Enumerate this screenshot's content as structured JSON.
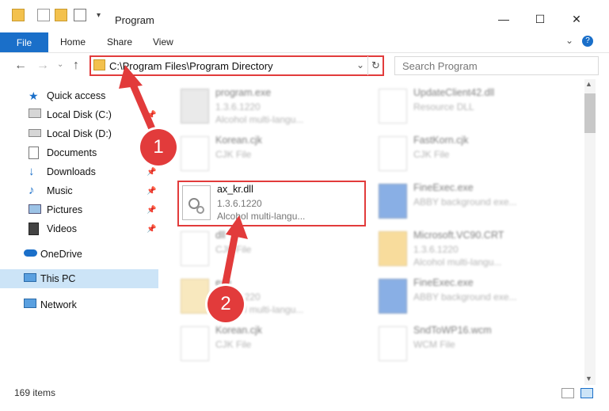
{
  "window": {
    "title": "Program",
    "min": "—",
    "max": "☐",
    "close": "✕"
  },
  "ribbon": {
    "tabs": [
      "File",
      "Home",
      "Share",
      "View"
    ],
    "expand": "⌄",
    "help": "?"
  },
  "address": {
    "path": "C:\\Program Files\\Program Directory",
    "dropdown": "⌄",
    "refresh": "↻"
  },
  "search": {
    "placeholder": "Search Program"
  },
  "nav": [
    {
      "label": "Quick access",
      "icon": "star-icon",
      "pinned": false
    },
    {
      "label": "Local Disk (C:)",
      "icon": "drive-icon",
      "pinned": true
    },
    {
      "label": "Local Disk (D:)",
      "icon": "drive-icon",
      "pinned": false
    },
    {
      "label": "Documents",
      "icon": "documents-icon",
      "pinned": false
    },
    {
      "label": "Downloads",
      "icon": "downloads-icon",
      "pinned": true
    },
    {
      "label": "Music",
      "icon": "music-icon",
      "pinned": true
    },
    {
      "label": "Pictures",
      "icon": "pictures-icon",
      "pinned": true
    },
    {
      "label": "Videos",
      "icon": "videos-icon",
      "pinned": true
    },
    {
      "label": "OneDrive",
      "icon": "cloud-icon",
      "pinned": false
    },
    {
      "label": "This PC",
      "icon": "pc-icon",
      "pinned": false
    },
    {
      "label": "Network",
      "icon": "network-icon",
      "pinned": false
    }
  ],
  "files": {
    "left": [
      {
        "name": "program.exe",
        "line2": "1.3.6.1220",
        "line3": "Alcohol multi-langu..."
      },
      {
        "name": "Korean.cjk",
        "line2": "CJK File",
        "line3": ""
      },
      {
        "name": "ax_kr.dll",
        "line2": "1.3.6.1220",
        "line3": "Alcohol multi-langu..."
      },
      {
        "name": "dll",
        "line2": "CJK File",
        "line3": ""
      },
      {
        "name": "exe",
        "line2": "1.3.6.1220",
        "line3": "Alcohol multi-langu..."
      },
      {
        "name": "Korean.cjk",
        "line2": "CJK File",
        "line3": ""
      }
    ],
    "right": [
      {
        "name": "UpdateClient42.dll",
        "line2": "Resource DLL",
        "line3": ""
      },
      {
        "name": "FastKorn.cjk",
        "line2": "CJK File",
        "line3": ""
      },
      {
        "name": "FineExec.exe",
        "line2": "ABBY background exe...",
        "line3": ""
      },
      {
        "name": "Microsoft.VC90.CRT",
        "line2": "1.3.6.1220",
        "line3": "Alcohol multi-langu..."
      },
      {
        "name": "FineExec.exe",
        "line2": "ABBY background exe...",
        "line3": ""
      },
      {
        "name": "SndToWP16.wcm",
        "line2": "WCM File",
        "line3": ""
      }
    ]
  },
  "status": {
    "count": "169 items"
  },
  "markers": {
    "one": "1",
    "two": "2"
  },
  "colors": {
    "accent": "#1a6fc9",
    "highlight": "#e23b3b",
    "selection": "#cce4f7"
  }
}
